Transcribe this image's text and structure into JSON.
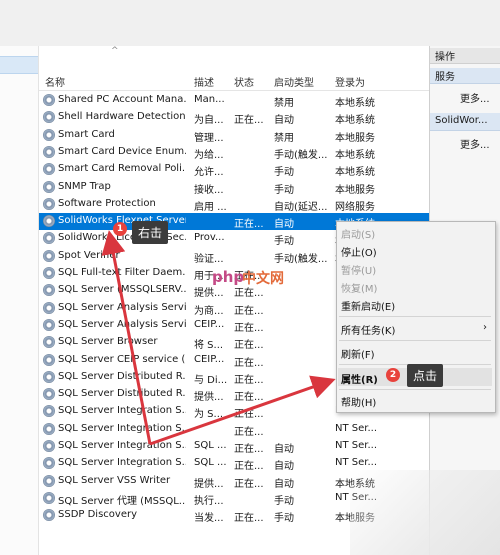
{
  "columns": {
    "name": "名称",
    "desc": "描述",
    "status": "状态",
    "startup": "启动类型",
    "logon": "登录为"
  },
  "rows": [
    {
      "name": "Shared PC Account Mana...",
      "desc": "Man...",
      "status": "",
      "startup": "禁用",
      "logon": "本地系统"
    },
    {
      "name": "Shell Hardware Detection",
      "desc": "为自...",
      "status": "正在...",
      "startup": "自动",
      "logon": "本地系统"
    },
    {
      "name": "Smart Card",
      "desc": "管理...",
      "status": "",
      "startup": "禁用",
      "logon": "本地服务"
    },
    {
      "name": "Smart Card Device Enum...",
      "desc": "为给...",
      "status": "",
      "startup": "手动(触发...",
      "logon": "本地系统"
    },
    {
      "name": "Smart Card Removal Poli...",
      "desc": "允许...",
      "status": "",
      "startup": "手动",
      "logon": "本地系统"
    },
    {
      "name": "SNMP Trap",
      "desc": "接收...",
      "status": "",
      "startup": "手动",
      "logon": "本地服务"
    },
    {
      "name": "Software Protection",
      "desc": "启用 ...",
      "status": "",
      "startup": "自动(延迟...",
      "logon": "网络服务"
    },
    {
      "name": "SolidWorks Flexnet Server",
      "desc": "",
      "status": "正在...",
      "startup": "自动",
      "logon": "本地系统"
    },
    {
      "name": "SolidWorks Licensing Sec...",
      "desc": "Prov...",
      "status": "",
      "startup": "手动",
      "logon": "本地系统"
    },
    {
      "name": "Spot Verifier",
      "desc": "验证...",
      "status": "",
      "startup": "手动(触发...",
      "logon": "本地系统"
    },
    {
      "name": "SQL Full-text Filter Daem...",
      "desc": "用于...",
      "status": "正在...",
      "startup": "",
      "logon": ""
    },
    {
      "name": "SQL Server (MSSQLSERV...",
      "desc": "提供...",
      "status": "正在...",
      "startup": "",
      "logon": ""
    },
    {
      "name": "SQL Server Analysis Servi...",
      "desc": "为商...",
      "status": "正在...",
      "startup": "",
      "logon": ""
    },
    {
      "name": "SQL Server Analysis Servi...",
      "desc": "CEIP...",
      "status": "正在...",
      "startup": "",
      "logon": ""
    },
    {
      "name": "SQL Server Browser",
      "desc": "将 S...",
      "status": "正在...",
      "startup": "",
      "logon": ""
    },
    {
      "name": "SQL Server CEIP service (...",
      "desc": "CEIP...",
      "status": "正在...",
      "startup": "",
      "logon": ""
    },
    {
      "name": "SQL Server Distributed R...",
      "desc": "与 Di...",
      "status": "正在...",
      "startup": "",
      "logon": ""
    },
    {
      "name": "SQL Server Distributed R...",
      "desc": "提供...",
      "status": "正在...",
      "startup": "",
      "logon": ""
    },
    {
      "name": "SQL Server Integration S...",
      "desc": "为 S...",
      "status": "正在...",
      "startup": "",
      "logon": "NT Ser..."
    },
    {
      "name": "SQL Server Integration S...",
      "desc": "",
      "status": "正在...",
      "startup": "",
      "logon": "NT Ser..."
    },
    {
      "name": "SQL Server Integration S...",
      "desc": "SQL ...",
      "status": "正在...",
      "startup": "自动",
      "logon": "NT Ser..."
    },
    {
      "name": "SQL Server Integration S...",
      "desc": "SQL ...",
      "status": "正在...",
      "startup": "自动",
      "logon": "NT Ser..."
    },
    {
      "name": "SQL Server VSS Writer",
      "desc": "提供...",
      "status": "正在...",
      "startup": "自动",
      "logon": "本地系统"
    },
    {
      "name": "SQL Server 代理 (MSSQL...",
      "desc": "执行...",
      "status": "",
      "startup": "手动",
      "logon": "NT Ser..."
    },
    {
      "name": "SSDP Discovery",
      "desc": "当发...",
      "status": "正在...",
      "startup": "手动",
      "logon": "本地服务"
    }
  ],
  "actions": {
    "title": "操作",
    "services": "服务",
    "more1": "更多...",
    "selected": "SolidWor...",
    "more2": "更多..."
  },
  "context_menu": {
    "start": "启动(S)",
    "stop": "停止(O)",
    "pause": "暂停(U)",
    "resume": "恢复(M)",
    "restart": "重新启动(E)",
    "all_tasks": "所有任务(K)",
    "refresh": "刷新(F)",
    "properties": "属性(R)",
    "help": "帮助(H)"
  },
  "annotations": {
    "right_click": "右击",
    "click": "点击",
    "badge1": "1",
    "badge2": "2"
  },
  "watermark": {
    "php": "php",
    "cn": "中文网"
  },
  "colors": {
    "selection": "#0078d7",
    "arrow": "#d9363e",
    "badge": "#e8423c"
  }
}
